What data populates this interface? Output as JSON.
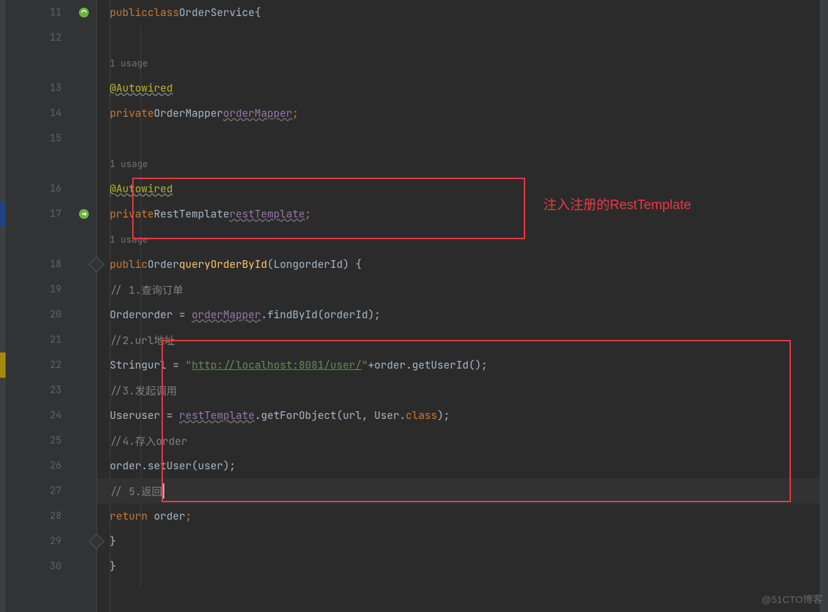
{
  "watermark": "@51CTO博客",
  "gutter": {
    "lines": [
      "11",
      "12",
      "",
      "13",
      "14",
      "15",
      "",
      "16",
      "17",
      "",
      "18",
      "19",
      "20",
      "21",
      "22",
      "23",
      "24",
      "25",
      "26",
      "27",
      "28",
      "29",
      "30"
    ]
  },
  "annotation": {
    "text1": "注入注册的RestTemplate"
  },
  "code": {
    "l11": {
      "public": "public",
      "class": "class",
      "name": "OrderService",
      "brace": "{"
    },
    "usage1": "1 usage",
    "usage2": "1 usage",
    "usage3": "1 usage",
    "l13": {
      "anno": "@Autowired"
    },
    "l14": {
      "private": "private",
      "type": "OrderMapper",
      "field": "orderMapper",
      "semi": ";"
    },
    "l16": {
      "anno": "@Autowired"
    },
    "l17": {
      "private": "private",
      "type": "RestTemplate",
      "field": "restTemplate",
      "semi": ";"
    },
    "l18": {
      "public": "public",
      "ret": "Order",
      "method": "queryOrderById",
      "paren": "(",
      "ptype": "Long",
      "pname": "orderId",
      "close": ") {"
    },
    "l19": {
      "c": "// 1.查询订单"
    },
    "l20": {
      "type": "Order",
      "var": "order",
      "eq": " = ",
      "field": "orderMapper",
      "dot": ".",
      "m": "findById",
      "arg": "(orderId);"
    },
    "l21": {
      "c": "//2.url地址"
    },
    "l22": {
      "type": "String",
      "var": "url",
      "eq": " = ",
      "q1": "\"",
      "url": "http://localhost:8081/user/",
      "q2": "\"",
      "plus": "+",
      "obj": "order",
      "dot": ".",
      "m": "getUserId",
      "tail": "();"
    },
    "l23": {
      "c": "//3.发起调用"
    },
    "l24": {
      "type": "User",
      "var": "user",
      "eq": " = ",
      "field": "restTemplate",
      "dot": ".",
      "m": "getForObject",
      "open": "(",
      "a1": "url",
      "comma": ", ",
      "a2": "User",
      "dot2": ".",
      "cls": "class",
      "close": ");"
    },
    "l25": {
      "c": "//4.存入order"
    },
    "l26": {
      "obj": "order",
      "dot": ".",
      "m": "setUser",
      "arg": "(user);"
    },
    "l27": {
      "c": "// 5.返回"
    },
    "l28": {
      "kw": "return",
      "sp": " ",
      "var": "order",
      "semi": ";"
    },
    "l29": {
      "b": "}"
    },
    "l30": {
      "b": "}"
    }
  }
}
